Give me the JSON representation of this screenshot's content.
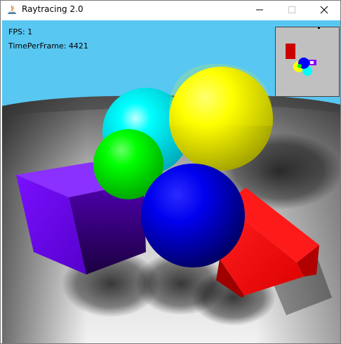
{
  "window": {
    "title": "Raytracing 2.0",
    "controls": {
      "minimize_icon": "minimize-icon",
      "maximize_icon": "maximize-icon",
      "close_icon": "close-icon"
    }
  },
  "hud": {
    "fps": "FPS: 1",
    "time_per_frame": "TimePerFrame: 4421"
  },
  "scene": {
    "sky_color": "#58c7f2",
    "objects": [
      {
        "kind": "sphere",
        "name": "cyan-sphere",
        "color": "#00ffff"
      },
      {
        "kind": "sphere",
        "name": "yellow-sphere",
        "color": "#ffff00"
      },
      {
        "kind": "sphere",
        "name": "green-sphere",
        "color": "#00ff00"
      },
      {
        "kind": "sphere",
        "name": "blue-sphere",
        "color": "#0000ff"
      },
      {
        "kind": "box",
        "name": "purple-box",
        "color": "#6a00ff"
      },
      {
        "kind": "box",
        "name": "red-box",
        "color": "#ff0000"
      }
    ]
  },
  "minimap": {
    "background": "#c0c0c0",
    "markers": [
      "#cc0000",
      "#ffff00",
      "#00ffff",
      "#0000ff",
      "#8800ff"
    ]
  }
}
